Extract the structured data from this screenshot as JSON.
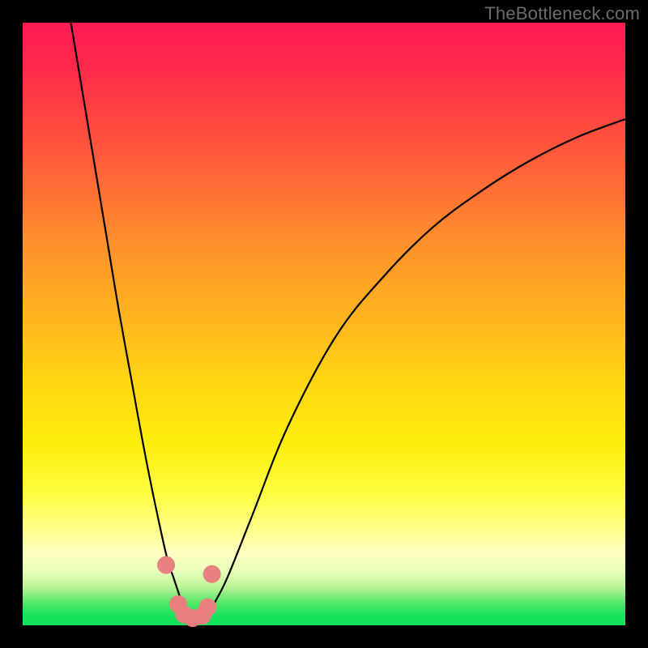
{
  "watermark": "TheBottleneck.com",
  "chart_data": {
    "type": "line",
    "title": "",
    "xlabel": "",
    "ylabel": "",
    "xlim": [
      0,
      100
    ],
    "ylim": [
      0,
      100
    ],
    "series": [
      {
        "name": "bottleneck-curve",
        "x": [
          8,
          10,
          12,
          14,
          16,
          18,
          20,
          22,
          24,
          25,
          26,
          27,
          28,
          29,
          30,
          31,
          32,
          34,
          38,
          44,
          52,
          60,
          68,
          76,
          84,
          92,
          100
        ],
        "values": [
          100,
          88,
          76,
          64,
          52,
          41,
          30,
          20,
          11,
          8,
          5,
          2,
          1,
          0.5,
          1,
          2,
          4,
          8,
          18,
          33,
          48,
          58,
          66,
          72,
          77,
          81,
          84
        ]
      },
      {
        "name": "highlight-dots",
        "x": [
          23.8,
          25.8,
          26.8,
          28.2,
          29.8,
          30.7,
          31.4
        ],
        "values": [
          10.0,
          3.5,
          1.8,
          1.2,
          1.6,
          3.0,
          8.5
        ]
      }
    ],
    "colors": {
      "curve": "#000000",
      "dots": "#e98080"
    }
  }
}
